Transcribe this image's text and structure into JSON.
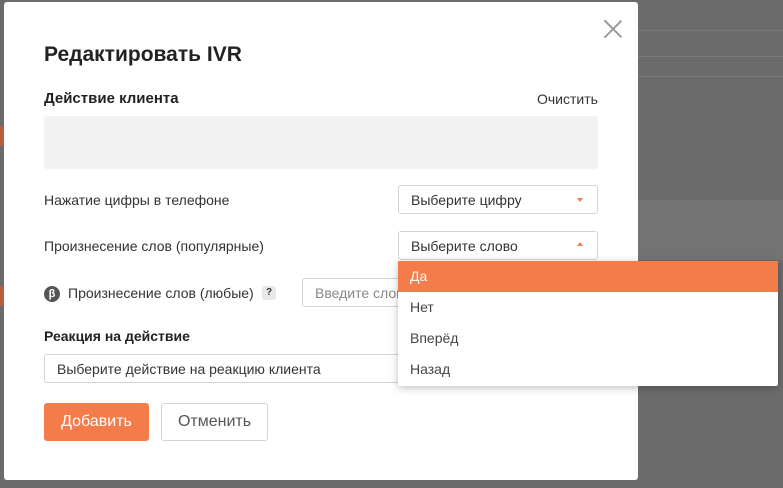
{
  "dialog": {
    "title": "Редактировать IVR",
    "client_action": {
      "heading": "Действие клиента",
      "clear_label": "Очистить"
    },
    "digit_press": {
      "label": "Нажатие цифры в телефоне",
      "select_value": "Выберите цифру"
    },
    "words_popular": {
      "label": "Произнесение слов (популярные)",
      "select_value": "Выберите слово",
      "options": [
        "Да",
        "Нет",
        "Вперёд",
        "Назад"
      ],
      "highlighted_option": "Да"
    },
    "words_any": {
      "beta_icon": "β",
      "label": "Произнесение слов (любые)",
      "help_icon": "?",
      "input_placeholder": "Введите слово"
    },
    "reaction": {
      "heading": "Реакция на действие",
      "select_value": "Выберите действие на реакцию клиента"
    },
    "buttons": {
      "add": "Добавить",
      "cancel": "Отменить"
    }
  },
  "colors": {
    "accent": "#f47c4a",
    "overlay": "#6b6b6b"
  }
}
